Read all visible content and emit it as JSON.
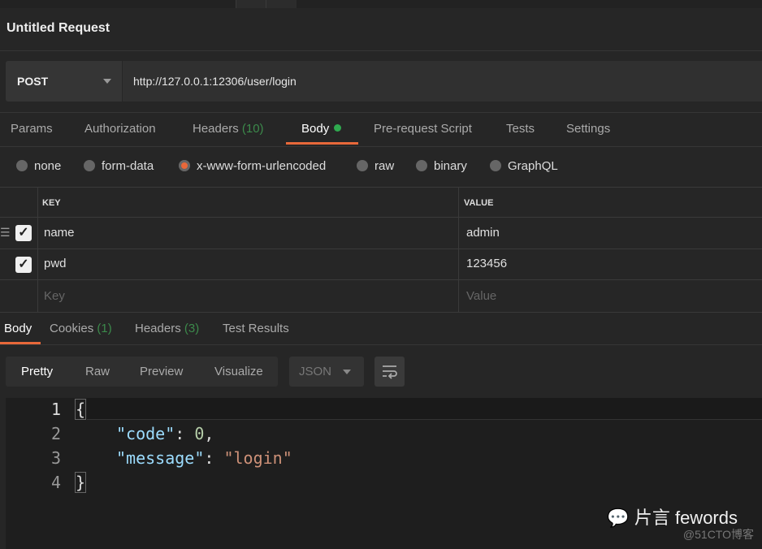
{
  "request": {
    "title": "Untitled Request",
    "method": "POST",
    "url": "http://127.0.0.1:12306/user/login"
  },
  "request_tabs": [
    {
      "label": "Params"
    },
    {
      "label": "Authorization"
    },
    {
      "label": "Headers",
      "count": "(10)"
    },
    {
      "label": "Body",
      "active": true
    },
    {
      "label": "Pre-request Script"
    },
    {
      "label": "Tests"
    },
    {
      "label": "Settings"
    }
  ],
  "body_types": [
    {
      "label": "none"
    },
    {
      "label": "form-data"
    },
    {
      "label": "x-www-form-urlencoded",
      "selected": true
    },
    {
      "label": "raw"
    },
    {
      "label": "binary"
    },
    {
      "label": "GraphQL"
    }
  ],
  "params_table": {
    "headers": {
      "key": "KEY",
      "value": "VALUE"
    },
    "rows": [
      {
        "key": "name",
        "value": "admin",
        "checked": true
      },
      {
        "key": "pwd",
        "value": "123456",
        "checked": true
      }
    ],
    "placeholder": {
      "key": "Key",
      "value": "Value"
    }
  },
  "response_tabs": [
    {
      "label": "Body",
      "active": true
    },
    {
      "label": "Cookies",
      "count": "(1)"
    },
    {
      "label": "Headers",
      "count": "(3)"
    },
    {
      "label": "Test Results"
    }
  ],
  "view_modes": [
    "Pretty",
    "Raw",
    "Preview",
    "Visualize"
  ],
  "format": "JSON",
  "code_lines": [
    {
      "num": "1",
      "text": "{"
    },
    {
      "num": "2",
      "key": "\"code\"",
      "sep": ": ",
      "val": "0",
      "tail": ","
    },
    {
      "num": "3",
      "key": "\"message\"",
      "sep": ": ",
      "val": "\"login\""
    },
    {
      "num": "4",
      "text": "}"
    }
  ],
  "watermark": {
    "brand": "片言 fewords",
    "source": "@51CTO博客"
  },
  "colors": {
    "accent": "#e8683a",
    "count_green": "#3c8a4b",
    "dot_green": "#2faa4f"
  }
}
